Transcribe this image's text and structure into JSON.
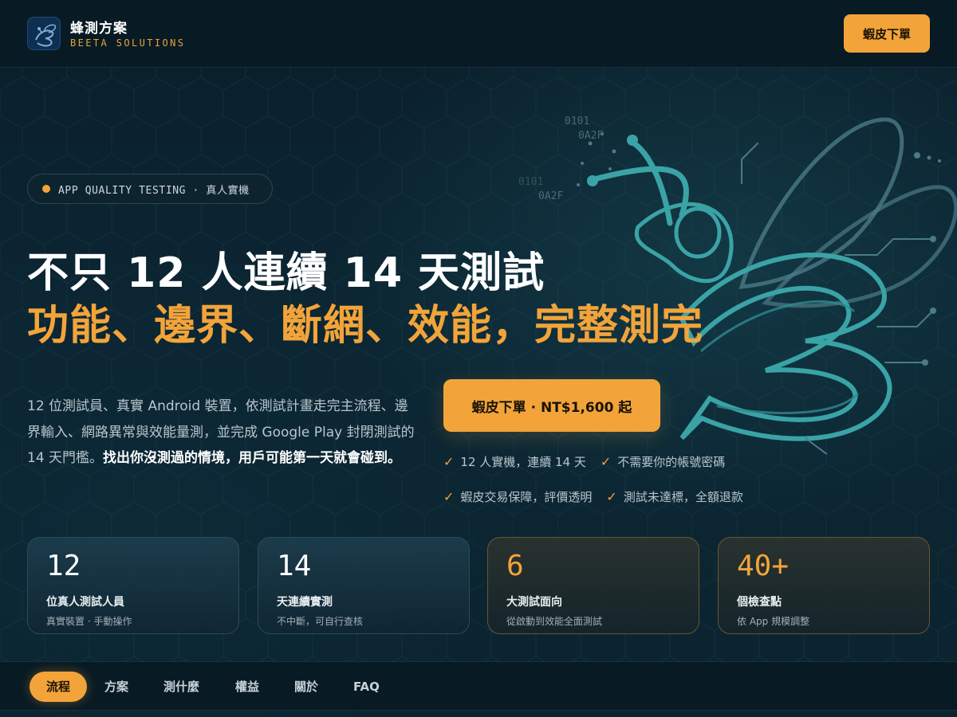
{
  "header": {
    "brand_name": "蜂測方案",
    "brand_sub": "BEETA SOLUTIONS",
    "order_button": "蝦皮下單",
    "logo_icon": "bee-circuit-logo"
  },
  "hero": {
    "pill": "APP QUALITY TESTING · 真人實機",
    "headline_1": "不只 12 人連續 14 天測試",
    "headline_2": "功能、邊界、斷網、效能，完整測完",
    "description": "12 位測試員、真實 Android 裝置，依測試計畫走完主流程、邊界輸入、網路異常與效能量測，並完成 Google Play 封閉測試的 14 天門檻。",
    "description_bold": "找出你沒測過的情境，用戶可能第一天就會碰到。",
    "cta": "蝦皮下單 · NT$1,600 起",
    "checks": [
      "12 人實機，連續 14 天",
      "不需要你的帳號密碼",
      "蝦皮交易保障，評價透明",
      "測試未達標，全額退款"
    ],
    "decor_codes": [
      "0101",
      "0A2F",
      "0101",
      "0A2F"
    ]
  },
  "stats": [
    {
      "number": "12",
      "title": "位真人測試人員",
      "sub": "真實裝置 · 手動操作"
    },
    {
      "number": "14",
      "title": "天連續實測",
      "sub": "不中斷，可自行查核"
    },
    {
      "number": "6",
      "title": "大測試面向",
      "sub": "從啟動到效能全面測試"
    },
    {
      "number": "40+",
      "title": "個檢查點",
      "sub": "依 App 規模調整"
    }
  ],
  "nav": {
    "items": [
      "流程",
      "方案",
      "測什麼",
      "權益",
      "關於",
      "FAQ"
    ],
    "active": "流程"
  },
  "colors": {
    "accent": "#f2a43a",
    "background": "#0b2230",
    "bee_line": "#4aa6a8"
  }
}
